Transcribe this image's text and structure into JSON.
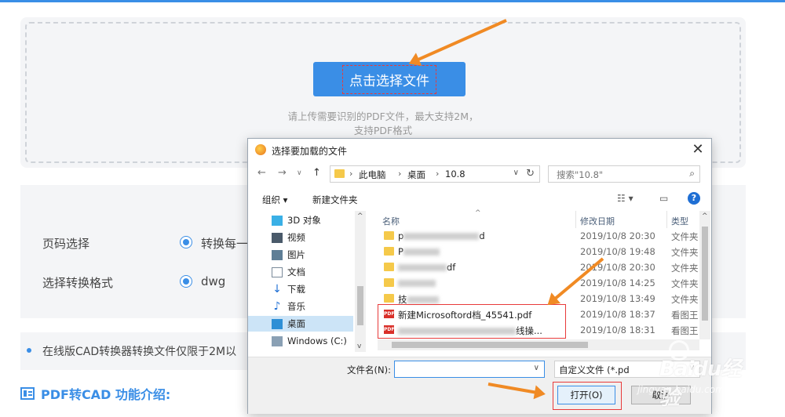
{
  "upload": {
    "button_label": "点击选择文件",
    "hint_line1": "请上传需要识别的PDF文件，最大支持2M，",
    "hint_line2": "支持PDF格式"
  },
  "settings": {
    "page_label": "页码选择",
    "page_option": "转换每一",
    "format_label": "选择转换格式",
    "format_option": "dwg"
  },
  "notice": {
    "text": "在线版CAD转换器转换文件仅限于2M以"
  },
  "section": {
    "title": "PDF转CAD 功能介绍:"
  },
  "dialog": {
    "title": "选择要加载的文件",
    "close_glyph": "✕",
    "breadcrumb": [
      "此电脑",
      "桌面",
      "10.8"
    ],
    "search_placeholder": "搜索\"10.8\"",
    "toolbar": {
      "organize": "组织 ▾",
      "new_folder": "新建文件夹"
    },
    "nav_tree": [
      {
        "label": "3D 对象",
        "icon": "3d-objects-icon"
      },
      {
        "label": "视频",
        "icon": "video-icon"
      },
      {
        "label": "图片",
        "icon": "pictures-icon"
      },
      {
        "label": "文档",
        "icon": "documents-icon"
      },
      {
        "label": "下载",
        "icon": "download-icon"
      },
      {
        "label": "音乐",
        "icon": "music-icon"
      },
      {
        "label": "桌面",
        "icon": "desktop-icon",
        "selected": true
      },
      {
        "label": "Windows (C:)",
        "icon": "drive-icon"
      }
    ],
    "columns": {
      "name": "名称",
      "date": "修改日期",
      "type": "类型"
    },
    "files": [
      {
        "name_prefix": "p",
        "name_suffix": "d",
        "date": "2019/10/8 20:30",
        "type": "文件夹",
        "kind": "folder"
      },
      {
        "name_prefix": "P",
        "name_suffix": "",
        "date": "2019/10/8 19:48",
        "type": "文件夹",
        "kind": "folder"
      },
      {
        "name_prefix": "",
        "name_suffix": "df",
        "date": "2019/10/8 20:30",
        "type": "文件夹",
        "kind": "folder"
      },
      {
        "name_prefix": "",
        "name_suffix": "",
        "date": "2019/10/8 14:25",
        "type": "文件夹",
        "kind": "folder"
      },
      {
        "name_prefix": "技",
        "name_suffix": "",
        "date": "2019/10/8 13:49",
        "type": "文件夹",
        "kind": "folder"
      },
      {
        "name_prefix": "新建Microsoftord档_45541.pdf",
        "name_suffix": "",
        "date": "2019/10/8 18:37",
        "type": "看图王",
        "kind": "pdf"
      },
      {
        "name_prefix": "",
        "name_suffix": "线操...",
        "date": "2019/10/8 18:31",
        "type": "看图王",
        "kind": "pdf"
      }
    ],
    "filename_label": "文件名(N):",
    "filename_value": "",
    "filter_value": "自定义文件 (*.pd",
    "open_label": "打开(O)",
    "cancel_label": "取消"
  },
  "watermark": {
    "logo": "Baidu经验",
    "url": "jingyan.baidu.com"
  },
  "colors": {
    "accent": "#3a8ee6",
    "arrow": "#f08a24",
    "highlight": "#e83a3a"
  }
}
